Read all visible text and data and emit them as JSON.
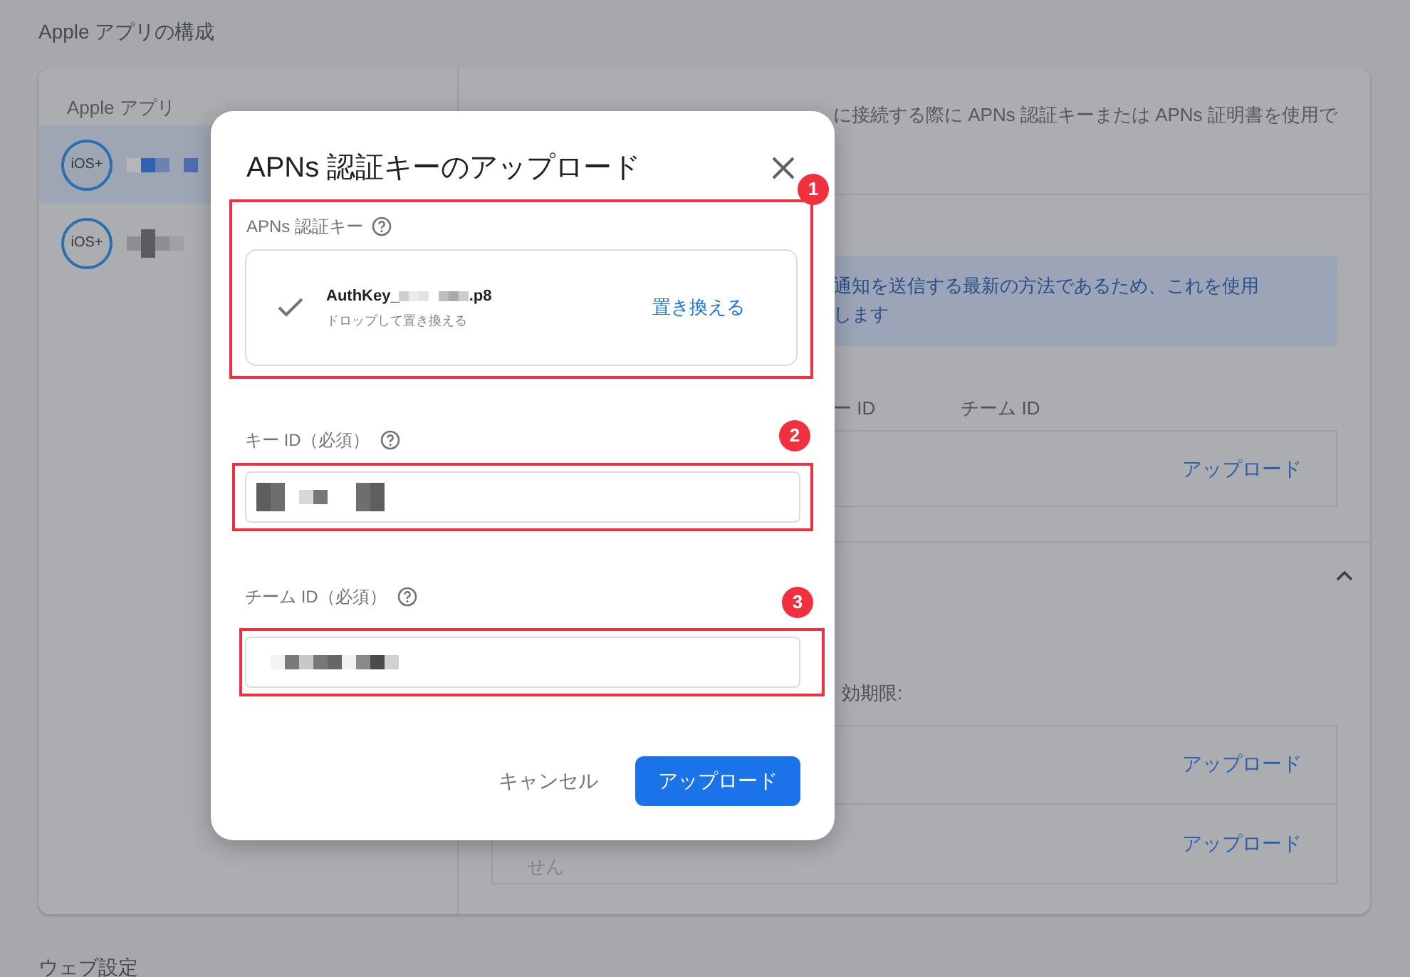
{
  "page": {
    "title": "Apple アプリの構成",
    "apps_header": "Apple アプリ",
    "apps": [
      {
        "badge": "iOS+",
        "selected": true
      },
      {
        "badge": "iOS+",
        "selected": false
      }
    ],
    "description": "に接続する際に APNs 認証キーまたは APNs 証明書を使用で",
    "info": [
      "通知を送信する最新の方法であるため、これを使用",
      "します"
    ],
    "key_columns": [
      "ー ID",
      "チーム ID"
    ],
    "key_upload": "アップロード",
    "section_expanded": true,
    "expiry_label": "効期限:",
    "cert_rows": [
      {
        "action": "アップロード"
      },
      {
        "action": "アップロード",
        "note": "せん"
      }
    ],
    "next_section": "ウェブ設定"
  },
  "dialog": {
    "title": "APNs 認証キーのアップロード",
    "file_key": {
      "label": "APNs 認証キー",
      "uploaded": true,
      "filename_prefix": "AuthKey_",
      "filename_suffix": ".p8",
      "hint": "ドロップして置き換える",
      "action": "置き換える"
    },
    "fields": [
      {
        "label": "キー ID（必須）"
      },
      {
        "label": "チーム ID（必須）"
      }
    ],
    "cancel": "キャンセル",
    "submit": "アップロード"
  },
  "annotations": [
    "1",
    "2",
    "3"
  ]
}
